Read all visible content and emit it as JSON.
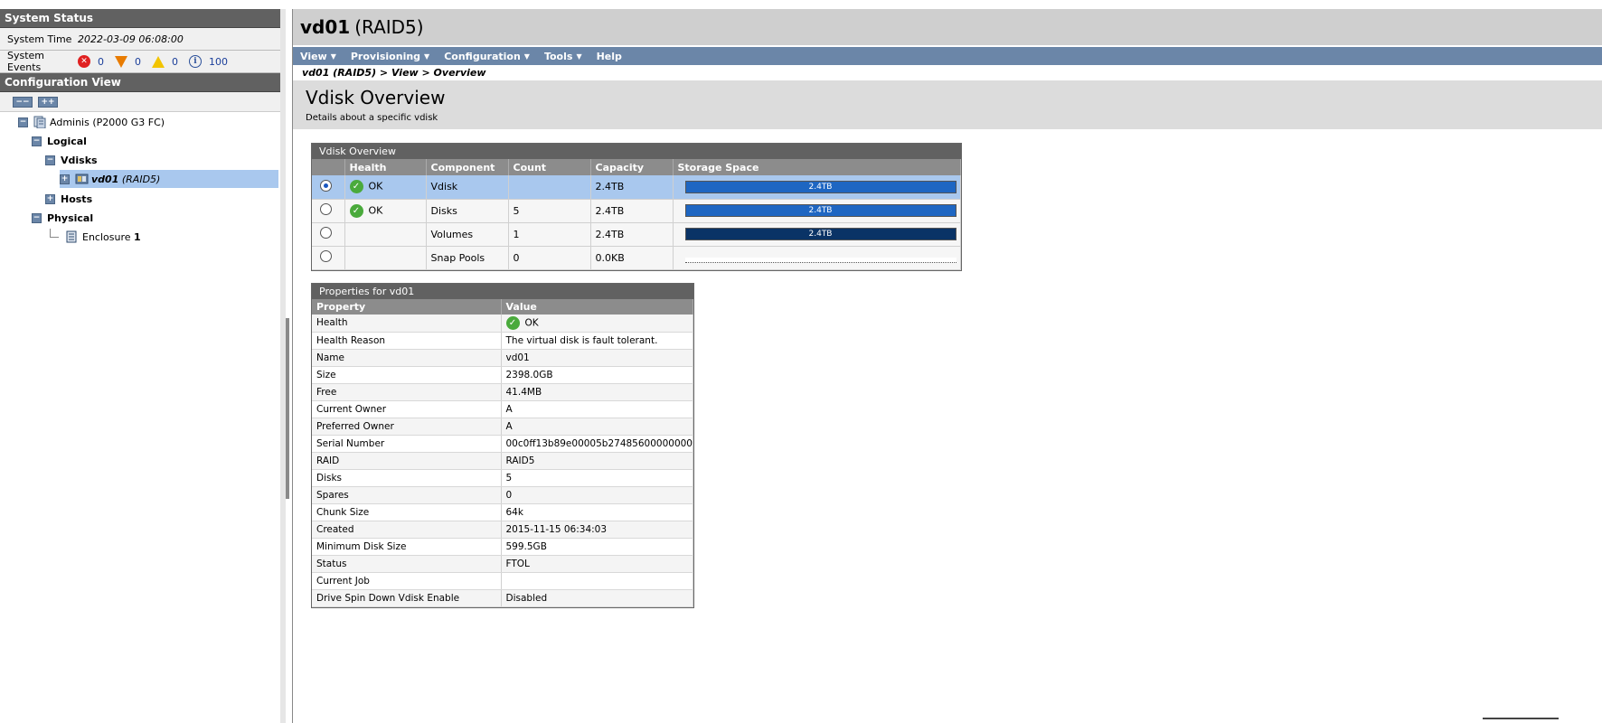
{
  "system_status": {
    "header": "System Status",
    "time_label": "System Time",
    "time_value": "2022-03-09 06:08:00",
    "events_label": "System Events",
    "critical_count": "0",
    "error_count": "0",
    "warning_count": "0",
    "info_count": "100"
  },
  "config_view": {
    "header": "Configuration View",
    "collapse_all": "−−",
    "expand_all": "++",
    "tree": {
      "root": "Adminis (P2000 G3 FC)",
      "logical": "Logical",
      "vdisks": "Vdisks",
      "vdisk_name": "vd01",
      "vdisk_raid": "(RAID5)",
      "hosts": "Hosts",
      "physical": "Physical",
      "enclosure": "Enclosure",
      "enclosure_num": "1"
    }
  },
  "title": {
    "name": "vd01",
    "raid": "(RAID5)"
  },
  "menu": [
    "View",
    "Provisioning",
    "Configuration",
    "Tools",
    "Help"
  ],
  "breadcrumb": "vd01 (RAID5) > View > Overview",
  "page": {
    "heading": "Vdisk Overview",
    "description": "Details about a specific vdisk"
  },
  "overview": {
    "title": "Vdisk Overview",
    "columns": [
      "",
      "Health",
      "Component",
      "Count",
      "Capacity",
      "Storage Space"
    ],
    "rows": [
      {
        "health": "OK",
        "component": "Vdisk",
        "count": "",
        "capacity": "2.4TB",
        "bar": "2.4TB",
        "selected": true
      },
      {
        "health": "OK",
        "component": "Disks",
        "count": "5",
        "capacity": "2.4TB",
        "bar": "2.4TB",
        "selected": false
      },
      {
        "health": "",
        "component": "Volumes",
        "count": "1",
        "capacity": "2.4TB",
        "bar": "2.4TB",
        "selected": false
      },
      {
        "health": "",
        "component": "Snap Pools",
        "count": "0",
        "capacity": "0.0KB",
        "bar": "",
        "selected": false
      }
    ]
  },
  "properties": {
    "title": "Properties for vd01",
    "col_property": "Property",
    "col_value": "Value",
    "health_label": "Health",
    "health_value": "OK",
    "rows": [
      [
        "Health Reason",
        "The virtual disk is fault tolerant."
      ],
      [
        "Name",
        "vd01"
      ],
      [
        "Size",
        "2398.0GB"
      ],
      [
        "Free",
        "41.4MB"
      ],
      [
        "Current Owner",
        "A"
      ],
      [
        "Preferred Owner",
        "A"
      ],
      [
        "Serial Number",
        "00c0ff13b89e00005b27485600000000"
      ],
      [
        "RAID",
        "RAID5"
      ],
      [
        "Disks",
        "5"
      ],
      [
        "Spares",
        "0"
      ],
      [
        "Chunk Size",
        "64k"
      ],
      [
        "Created",
        "2015-11-15 06:34:03"
      ],
      [
        "Minimum Disk Size",
        "599.5GB"
      ],
      [
        "Status",
        "FTOL"
      ],
      [
        "Current Job",
        ""
      ],
      [
        "Drive Spin Down Vdisk Enable",
        "Disabled"
      ]
    ]
  }
}
